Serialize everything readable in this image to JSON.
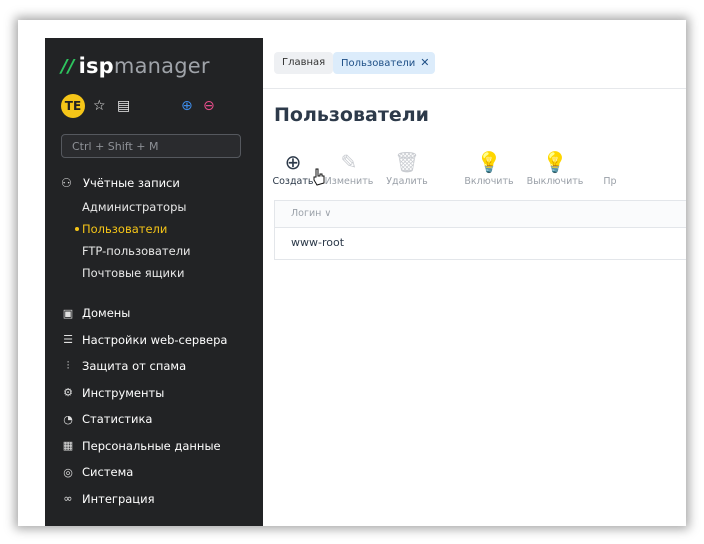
{
  "sidebar": {
    "logo": {
      "mark": "//",
      "isp": "isp",
      "manager": "manager"
    },
    "avatar_initials": "TE",
    "search_placeholder": "Ctrl + Shift + M",
    "accounts": {
      "label": "Учётные записи",
      "items": [
        {
          "label": "Администраторы",
          "active": false
        },
        {
          "label": "Пользователи",
          "active": true
        },
        {
          "label": "FTP-пользователи",
          "active": false
        },
        {
          "label": "Почтовые ящики",
          "active": false
        }
      ]
    },
    "menu": [
      {
        "label": "Домены",
        "icon": "domain-icon"
      },
      {
        "label": "Настройки web-сервера",
        "icon": "sliders-icon"
      },
      {
        "label": "Защита от спама",
        "icon": "filter-icon"
      },
      {
        "label": "Инструменты",
        "icon": "gear-icon"
      },
      {
        "label": "Статистика",
        "icon": "pie-chart-icon"
      },
      {
        "label": "Персональные данные",
        "icon": "document-icon"
      },
      {
        "label": "Система",
        "icon": "os-icon"
      },
      {
        "label": "Интеграция",
        "icon": "link-icon"
      }
    ]
  },
  "breadcrumbs": {
    "home": "Главная",
    "current": "Пользователи"
  },
  "page_title": "Пользователи",
  "toolbar": {
    "create": "Создать",
    "edit": "Изменить",
    "delete": "Удалить",
    "enable": "Включить",
    "disable": "Выключить",
    "more": "Пр"
  },
  "table": {
    "column": "Логин ∨",
    "rows": [
      {
        "login": "www-root"
      }
    ]
  },
  "colors": {
    "sidebar_bg": "#222325",
    "accent": "#f5c518",
    "brand_green": "#2ec55e",
    "active_tab": "#dcecfb"
  }
}
